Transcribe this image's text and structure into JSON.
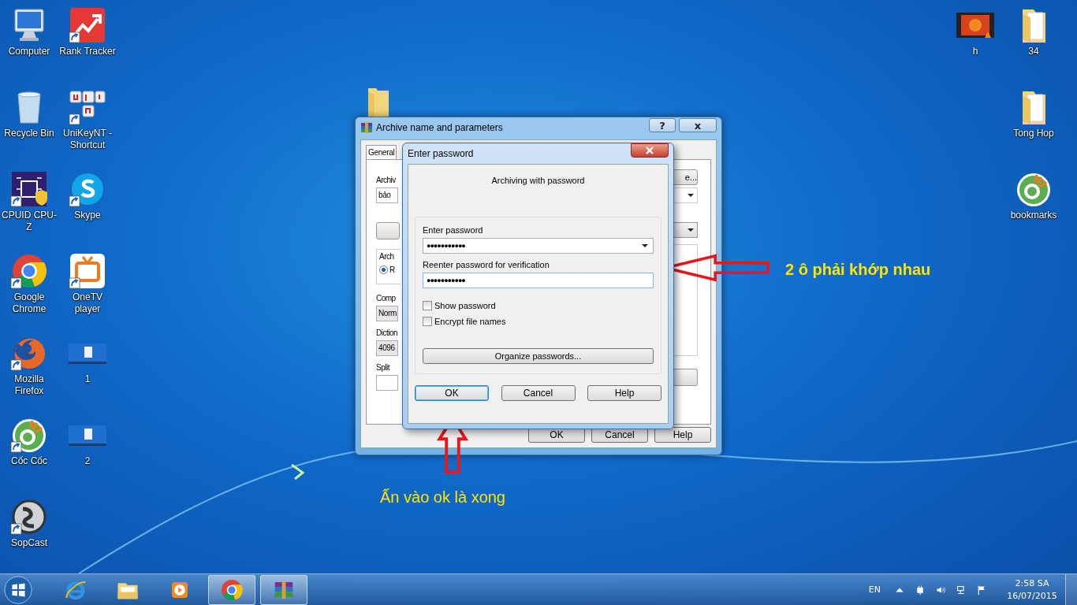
{
  "desktop": {
    "left_columns": [
      [
        {
          "label": "Computer",
          "kind": "computer",
          "shortcut": false
        },
        {
          "label": "Recycle Bin",
          "kind": "recycle-bin",
          "shortcut": false
        },
        {
          "label": "CPUID CPU-Z",
          "kind": "cpuz",
          "shortcut": true
        },
        {
          "label": "Google Chrome",
          "kind": "chrome",
          "shortcut": true
        },
        {
          "label": "Mozilla Firefox",
          "kind": "firefox",
          "shortcut": true
        },
        {
          "label": "Cốc Cốc",
          "kind": "coccoc",
          "shortcut": true
        },
        {
          "label": "SopCast",
          "kind": "sopcast",
          "shortcut": true
        }
      ],
      [
        {
          "label": "Rank Tracker",
          "kind": "rank-tracker",
          "shortcut": true
        },
        {
          "label": "UniKeyNT - Shortcut",
          "kind": "unikey",
          "shortcut": true
        },
        {
          "label": "Skype",
          "kind": "skype",
          "shortcut": true
        },
        {
          "label": "OneTV player",
          "kind": "onetv",
          "shortcut": true
        },
        {
          "label": "1",
          "kind": "screenshot",
          "shortcut": false
        },
        {
          "label": "2",
          "kind": "screenshot",
          "shortcut": false
        }
      ]
    ],
    "right_columns": [
      [
        {
          "label": "h",
          "kind": "video",
          "shortcut": false
        }
      ],
      [
        {
          "label": "34",
          "kind": "folder",
          "shortcut": false
        },
        {
          "label": "Tong Hop",
          "kind": "folder",
          "shortcut": false
        },
        {
          "label": "bookmarks",
          "kind": "coccoc",
          "shortcut": false
        }
      ]
    ]
  },
  "archive_window": {
    "title": "Archive name and parameters",
    "help": "?",
    "close": "x",
    "tab": "General",
    "archive_label": "Archiv",
    "archive_value": "bảo",
    "group_label": "Arch",
    "radio": {
      "label": "R",
      "selected": true
    },
    "compression_label": "Comp",
    "compression_value": "Norm",
    "dictionary_label": "Diction",
    "dictionary_value": "4096",
    "split_label": "Split",
    "browse_button": "e...",
    "buttons": [
      "OK",
      "Cancel",
      "Help"
    ]
  },
  "password_dialog": {
    "title": "Enter password",
    "heading": "Archiving with password",
    "fields": [
      {
        "label": "Enter password",
        "value": "●●●●●●●●●●●",
        "kind": "combo",
        "focused": false
      },
      {
        "label": "Reenter password for verification",
        "value": "●●●●●●●●●●●",
        "kind": "text",
        "focused": true
      }
    ],
    "checkboxes": [
      {
        "label": "Show password",
        "checked": false
      },
      {
        "label": "Encrypt file names",
        "checked": false
      }
    ],
    "organize_button": "Organize passwords...",
    "buttons": [
      {
        "label": "OK",
        "selected": true
      },
      {
        "label": "Cancel",
        "selected": false
      },
      {
        "label": "Help",
        "selected": false
      }
    ]
  },
  "annotations": [
    {
      "text": "2 ô phải khớp nhau",
      "kind": "left-arrow"
    },
    {
      "text": "Ấn vào ok là xong",
      "kind": "up-arrow"
    }
  ],
  "taskbar": {
    "items": [
      {
        "kind": "ie",
        "selected": false
      },
      {
        "kind": "explorer",
        "selected": false
      },
      {
        "kind": "media",
        "selected": false
      },
      {
        "kind": "chrome",
        "selected": true
      },
      {
        "kind": "winrar",
        "selected": true
      }
    ],
    "language": "EN",
    "time": "2:58 SA",
    "date": "16/07/2015"
  }
}
